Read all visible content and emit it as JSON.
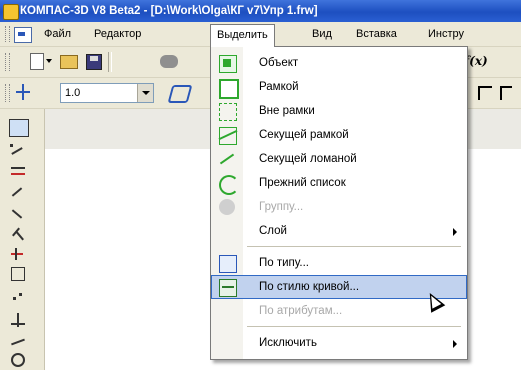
{
  "window": {
    "title": "КОМПАС-3D V8 Beta2 - [D:\\Work\\Olga\\КГ v7\\Упр 1.frw]"
  },
  "menubar": {
    "items": [
      "Файл",
      "Редактор",
      "Выделить",
      "Вид",
      "Вставка",
      "Инстру"
    ],
    "active": "Выделить"
  },
  "toolbar": {
    "line_width_value": "1.0",
    "icons": [
      "new-document",
      "open-folder",
      "save",
      "gray-shape",
      "function"
    ]
  },
  "dropdown": {
    "items": [
      {
        "label": "Объект",
        "icon": "object-select-icon",
        "enabled": true,
        "submenu": false
      },
      {
        "label": "Рамкой",
        "icon": "frame-select-icon",
        "enabled": true,
        "submenu": false
      },
      {
        "label": "Вне рамки",
        "icon": "outside-frame-icon",
        "enabled": true,
        "submenu": false
      },
      {
        "label": "Секущей рамкой",
        "icon": "crossing-frame-icon",
        "enabled": true,
        "submenu": false
      },
      {
        "label": "Секущей ломаной",
        "icon": "crossing-polyline-icon",
        "enabled": true,
        "submenu": false
      },
      {
        "label": "Прежний список",
        "icon": "previous-list-icon",
        "enabled": true,
        "submenu": false
      },
      {
        "label": "Группу...",
        "icon": "group-icon",
        "enabled": false,
        "submenu": false
      },
      {
        "label": "Слой",
        "icon": "",
        "enabled": true,
        "submenu": true
      },
      {
        "label": "По типу...",
        "icon": "by-type-icon",
        "enabled": true,
        "submenu": false
      },
      {
        "label": "По стилю кривой...",
        "icon": "curve-style-icon",
        "enabled": true,
        "submenu": false,
        "highlighted": true
      },
      {
        "label": "По атрибутам...",
        "icon": "",
        "enabled": false,
        "submenu": false
      },
      {
        "label": "Исключить",
        "icon": "",
        "enabled": true,
        "submenu": true
      }
    ]
  },
  "colors": {
    "titlebar": "#1d4fc0",
    "menu_bg": "#ece9d8",
    "highlight": "#c1d2ee",
    "icon_green": "#2ea82e"
  }
}
